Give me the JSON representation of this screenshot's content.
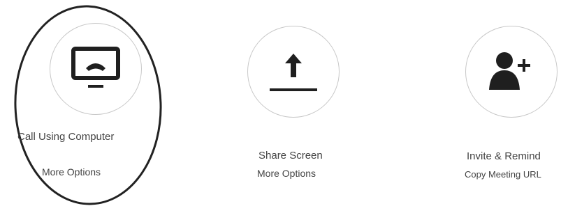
{
  "actions": [
    {
      "id": "call",
      "label": "Call Using Computer",
      "secondary": "More Options",
      "icon": "monitor-phone-icon"
    },
    {
      "id": "share",
      "label": "Share Screen",
      "secondary": "More Options",
      "icon": "upload-arrow-icon"
    },
    {
      "id": "invite",
      "label": "Invite & Remind",
      "secondary": "Copy Meeting URL",
      "icon": "add-person-icon"
    }
  ],
  "colors": {
    "icon": "#1f1f1f",
    "circle_border": "#c8c8c8",
    "text": "#444444",
    "annotation": "#222222"
  }
}
